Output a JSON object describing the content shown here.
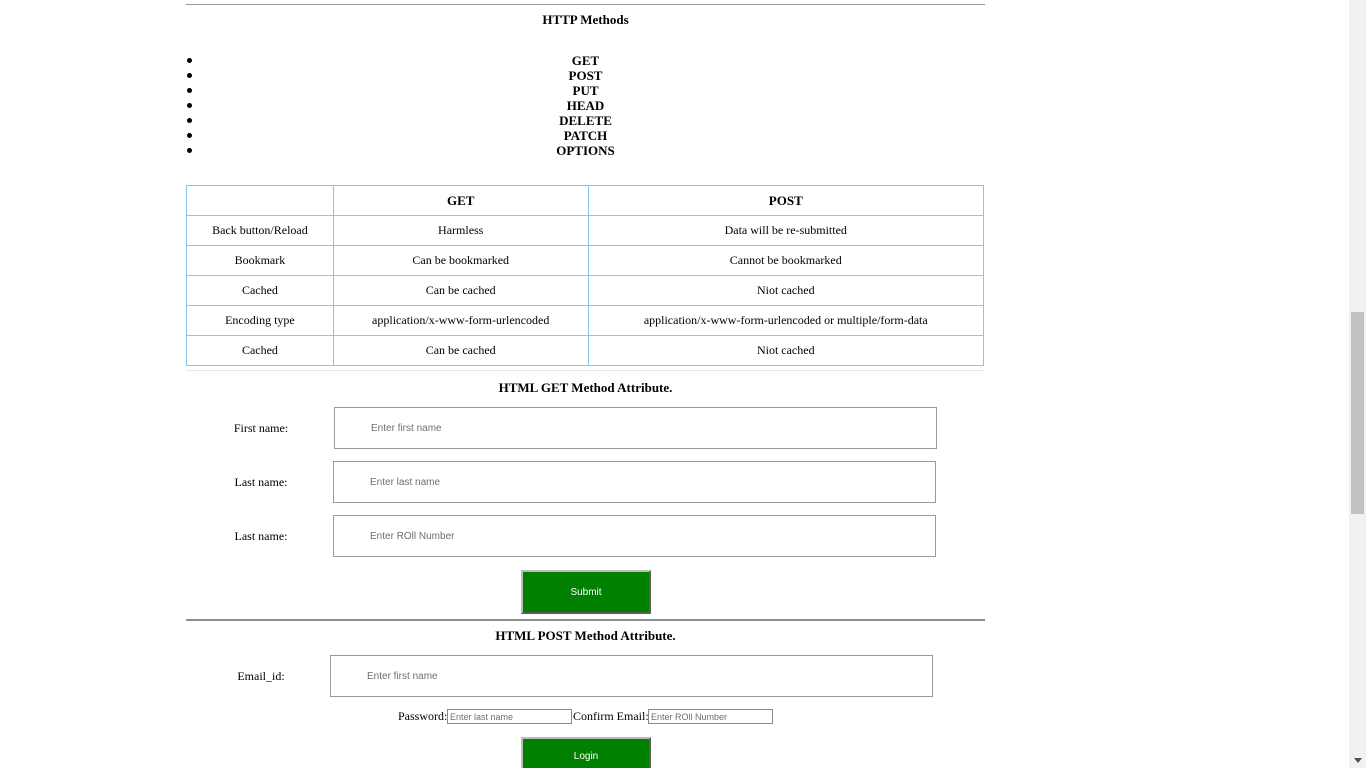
{
  "http_methods": {
    "title": "HTTP Methods",
    "items": [
      "GET",
      "POST",
      "PUT",
      "HEAD",
      "DELETE",
      "PATCH",
      "OPTIONS"
    ]
  },
  "comparison_table": {
    "headers": [
      "",
      "GET",
      "POST"
    ],
    "rows": [
      [
        "Back button/Reload",
        "Harmless",
        "Data will be re-submitted"
      ],
      [
        "Bookmark",
        "Can be bookmarked",
        "Cannot be bookmarked"
      ],
      [
        "Cached",
        "Can be cached",
        "Niot cached"
      ],
      [
        "Encoding type",
        "application/x-www-form-urlencoded",
        "application/x-www-form-urlencoded or multiple/form-data"
      ],
      [
        "Cached",
        "Can be cached",
        "Niot cached"
      ]
    ]
  },
  "get_form": {
    "title": "HTML GET Method Attribute.",
    "first_name_label": "First name:",
    "first_name_placeholder": "Enter first name",
    "last_name_label": "Last name:",
    "last_name_placeholder": "Enter last name",
    "roll_label": "Last name:",
    "roll_placeholder": "Enter ROll Number",
    "submit_label": "Submit"
  },
  "post_form": {
    "title": "HTML POST Method Attribute.",
    "email_label": "Email_id:",
    "email_placeholder": "Enter first name",
    "password_label": "Password:",
    "password_placeholder": "Enter last name",
    "confirm_label": "Confirm Email:",
    "confirm_placeholder": "Enter ROll Number",
    "login_label": "Login"
  },
  "colors": {
    "button_bg": "#008000",
    "table_border": "#87c6e8"
  }
}
